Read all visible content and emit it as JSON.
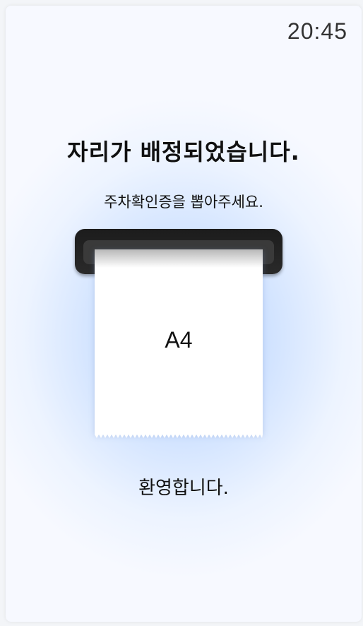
{
  "status_bar": {
    "time": "20:45"
  },
  "main": {
    "title": "자리가 배정되었습니다.",
    "instruction": "주차확인증을 뽑아주세요.",
    "ticket_label": "A4",
    "welcome": "환영합니다."
  },
  "colors": {
    "background_glow": "#b8d4ff",
    "slot": "#1c1c1c",
    "ticket": "#ffffff",
    "text": "#111111"
  }
}
